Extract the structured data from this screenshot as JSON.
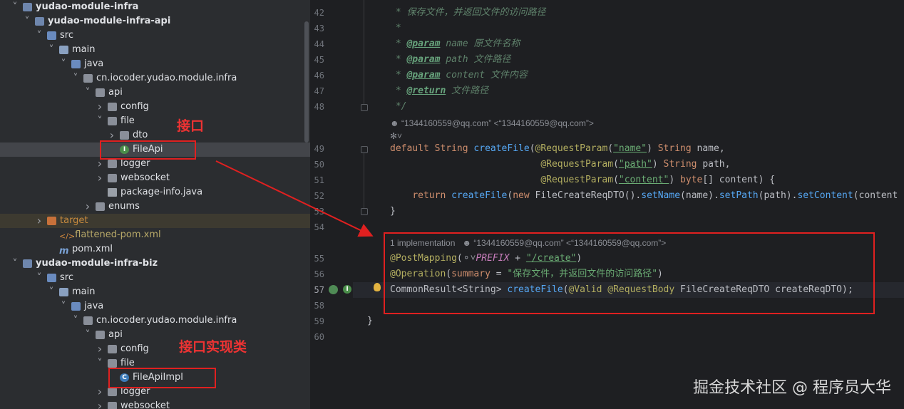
{
  "tree": {
    "rows": [
      {
        "label": "yudao-module-infra",
        "bold": true
      },
      {
        "label": "yudao-module-infra-api",
        "bold": true
      },
      {
        "label": "src"
      },
      {
        "label": "main"
      },
      {
        "label": "java"
      },
      {
        "label": "cn.iocoder.yudao.module.infra"
      },
      {
        "label": "api"
      },
      {
        "label": "config"
      },
      {
        "label": "file"
      },
      {
        "label": "dto"
      },
      {
        "label": "FileApi"
      },
      {
        "label": "logger"
      },
      {
        "label": "websocket"
      },
      {
        "label": "package-info.java"
      },
      {
        "label": "enums"
      },
      {
        "label": "target"
      },
      {
        "label": ".flattened-pom.xml"
      },
      {
        "label": "pom.xml"
      },
      {
        "label": "yudao-module-infra-biz",
        "bold": true
      },
      {
        "label": "src"
      },
      {
        "label": "main"
      },
      {
        "label": "java"
      },
      {
        "label": "cn.iocoder.yudao.module.infra"
      },
      {
        "label": "api"
      },
      {
        "label": "config"
      },
      {
        "label": "file"
      },
      {
        "label": "FileApiImpl"
      },
      {
        "label": "logger"
      },
      {
        "label": "websocket"
      }
    ]
  },
  "annotations": {
    "interface_label": "接口",
    "impl_label": "接口实现类"
  },
  "editor": {
    "line_numbers": [
      "42",
      "43",
      "44",
      "45",
      "46",
      "47",
      "48",
      "49",
      "50",
      "51",
      "52",
      "53",
      "54",
      "55",
      "56",
      "57",
      "58",
      "59",
      "60"
    ],
    "javadoc": {
      "l42": "保存文件，并返回文件的访问路径",
      "l43": "*",
      "tag_param": "@param",
      "tag_return": "@return",
      "name": "name",
      "name_desc": "原文件名称",
      "path": "path",
      "path_desc": "文件路径",
      "content": "content",
      "content_desc": "文件内容",
      "return_desc": "文件路径",
      "close": "*/"
    },
    "author_hint": "“1344160559@qq.com” <“1344160559@qq.com”>",
    "impl_hint": "1 implementation",
    "code": {
      "default": "default",
      "String": "String",
      "createFile": "createFile",
      "RequestParam": "@RequestParam",
      "q_name": "\"name\"",
      "q_path": "\"path\"",
      "q_content": "\"content\"",
      "byte": "byte",
      "return": "return",
      "new": "new",
      "dto_call": "FileCreateReqDTO().",
      "setName": "setName",
      "setPath": "setPath",
      "setContent": "setContent",
      "PostMapping": "@PostMapping",
      "PREFIX": "PREFIX",
      "create_path": "\"/create\"",
      "Operation": "@Operation",
      "summary": "summary",
      "summary_str": "\"保存文件，并返回文件的访问路径\"",
      "CommonResult": "CommonResult<String>",
      "Valid": "@Valid",
      "RequestBody": "@RequestBody",
      "dto_param": "FileCreateReqDTO createReqDTO);",
      "brace_close": "}"
    }
  },
  "watermark": "掘金技术社区 @ 程序员大华",
  "colors": {
    "annotation_red": "#e02020",
    "tree_bg": "#2b2d30",
    "editor_bg": "#1e1f22"
  }
}
